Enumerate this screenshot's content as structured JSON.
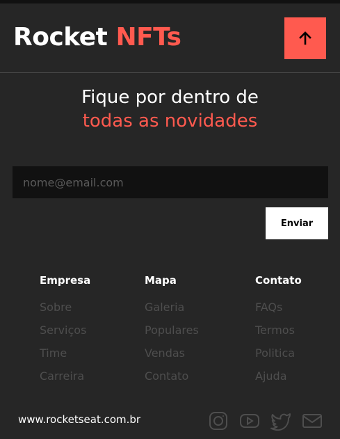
{
  "header": {
    "logo_main": "Rocket",
    "logo_accent": "NFTs",
    "scroll_top_icon": "arrow-up-icon"
  },
  "newsletter": {
    "title_line1": "Fique por dentro de",
    "title_line2": "todas as novidades",
    "email_placeholder": "nome@email.com",
    "email_value": "",
    "submit_label": "Enviar"
  },
  "footer": {
    "columns": [
      {
        "heading": "Empresa",
        "links": [
          "Sobre",
          "Serviços",
          "Time",
          "Carreira"
        ]
      },
      {
        "heading": "Mapa",
        "links": [
          "Galeria",
          "Populares",
          "Vendas",
          "Contato"
        ]
      },
      {
        "heading": "Contato",
        "links": [
          "FAQs",
          "Termos",
          "Politica",
          "Ajuda"
        ]
      }
    ],
    "site_url": "www.rocketseat.com.br",
    "social_icons": [
      "instagram-icon",
      "youtube-icon",
      "twitter-icon",
      "mail-icon"
    ]
  },
  "colors": {
    "background": "#262626",
    "accent": "#ff5a4f",
    "input_bg": "#111111",
    "link_muted": "#4e4e4e"
  }
}
